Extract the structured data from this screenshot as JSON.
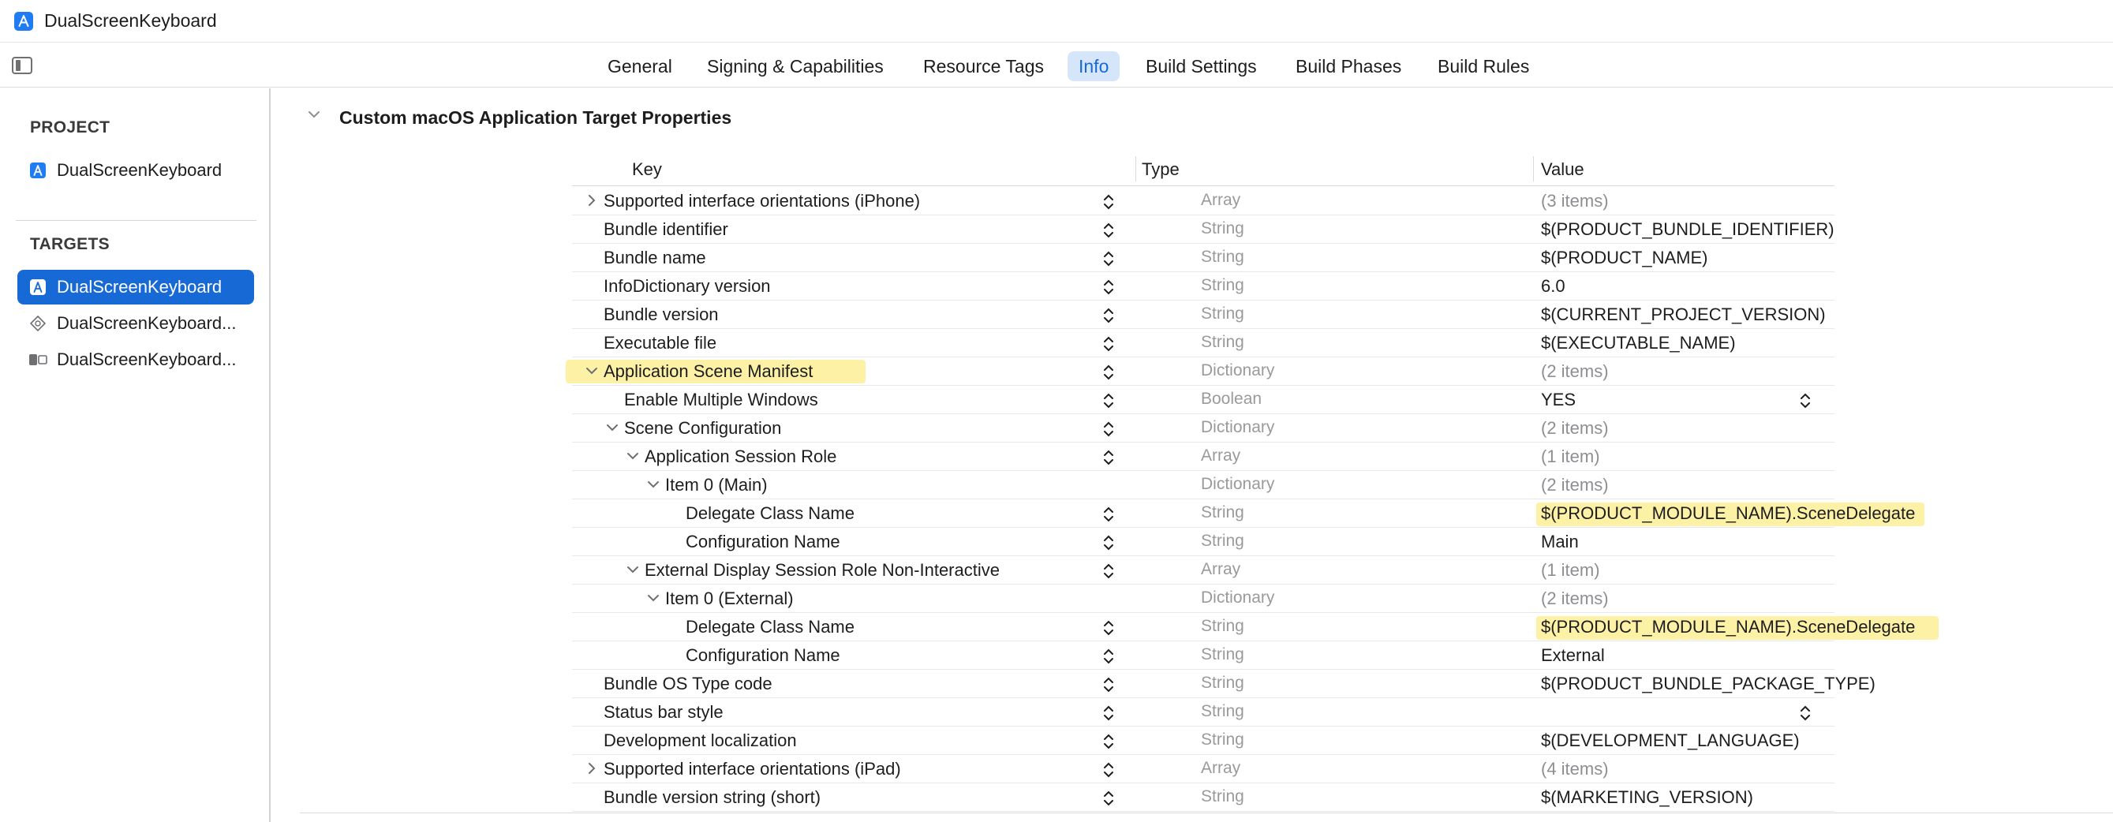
{
  "window": {
    "title": "DualScreenKeyboard"
  },
  "tabs": [
    {
      "label": "General",
      "active": false
    },
    {
      "label": "Signing & Capabilities",
      "active": false
    },
    {
      "label": "Resource Tags",
      "active": false
    },
    {
      "label": "Info",
      "active": true
    },
    {
      "label": "Build Settings",
      "active": false
    },
    {
      "label": "Build Phases",
      "active": false
    },
    {
      "label": "Build Rules",
      "active": false
    }
  ],
  "sidebar": {
    "project_header": "PROJECT",
    "project_item": "DualScreenKeyboard",
    "targets_header": "TARGETS",
    "targets": [
      {
        "label": "DualScreenKeyboard",
        "icon": "app-target-icon",
        "selected": true
      },
      {
        "label": "DualScreenKeyboard...",
        "icon": "extension-target-icon",
        "selected": false
      },
      {
        "label": "DualScreenKeyboard...",
        "icon": "test-target-icon",
        "selected": false
      }
    ]
  },
  "main": {
    "section_title": "Custom macOS Application Target Properties",
    "columns": {
      "key": "Key",
      "type": "Type",
      "value": "Value"
    },
    "rows": [
      {
        "key": "Supported interface orientations (iPhone)",
        "type": "Array",
        "value": "(3 items)",
        "indent": 0,
        "disclosure": "collapsed",
        "stepper": true,
        "value_dim": true
      },
      {
        "key": "Bundle identifier",
        "type": "String",
        "value": "$(PRODUCT_BUNDLE_IDENTIFIER)",
        "indent": 0,
        "stepper": true
      },
      {
        "key": "Bundle name",
        "type": "String",
        "value": "$(PRODUCT_NAME)",
        "indent": 0,
        "stepper": true
      },
      {
        "key": "InfoDictionary version",
        "type": "String",
        "value": "6.0",
        "indent": 0,
        "stepper": true
      },
      {
        "key": "Bundle version",
        "type": "String",
        "value": "$(CURRENT_PROJECT_VERSION)",
        "indent": 0,
        "stepper": true
      },
      {
        "key": "Executable file",
        "type": "String",
        "value": "$(EXECUTABLE_NAME)",
        "indent": 0,
        "stepper": true
      },
      {
        "key": "Application Scene Manifest",
        "type": "Dictionary",
        "value": "(2 items)",
        "indent": 0,
        "disclosure": "expanded",
        "stepper": true,
        "value_dim": true,
        "highlight_key": true
      },
      {
        "key": "Enable Multiple Windows",
        "type": "Boolean",
        "value": "YES",
        "indent": 1,
        "stepper": true,
        "popup": true
      },
      {
        "key": "Scene Configuration",
        "type": "Dictionary",
        "value": "(2 items)",
        "indent": 1,
        "disclosure": "expanded",
        "stepper": true,
        "value_dim": true
      },
      {
        "key": "Application Session Role",
        "type": "Array",
        "value": "(1 item)",
        "indent": 2,
        "disclosure": "expanded",
        "stepper": true,
        "value_dim": true
      },
      {
        "key": "Item 0 (Main)",
        "type": "Dictionary",
        "value": "(2 items)",
        "indent": 3,
        "disclosure": "expanded",
        "stepper": false,
        "value_dim": true
      },
      {
        "key": "Delegate Class Name",
        "type": "String",
        "value": "$(PRODUCT_MODULE_NAME).SceneDelegate",
        "indent": 4,
        "stepper": true,
        "highlight_value": true
      },
      {
        "key": "Configuration Name",
        "type": "String",
        "value": "Main",
        "indent": 4,
        "stepper": true
      },
      {
        "key": "External Display Session Role Non-Interactive",
        "type": "Array",
        "value": "(1 item)",
        "indent": 2,
        "disclosure": "expanded",
        "stepper": true,
        "value_dim": true
      },
      {
        "key": "Item 0 (External)",
        "type": "Dictionary",
        "value": "(2 items)",
        "indent": 3,
        "disclosure": "expanded",
        "stepper": false,
        "value_dim": true
      },
      {
        "key": "Delegate Class Name",
        "type": "String",
        "value": "$(PRODUCT_MODULE_NAME).SceneDelegate",
        "indent": 4,
        "stepper": true,
        "highlight_value": true
      },
      {
        "key": "Configuration Name",
        "type": "String",
        "value": "External",
        "indent": 4,
        "stepper": true
      },
      {
        "key": "Bundle OS Type code",
        "type": "String",
        "value": "$(PRODUCT_BUNDLE_PACKAGE_TYPE)",
        "indent": 0,
        "stepper": true
      },
      {
        "key": "Status bar style",
        "type": "String",
        "value": "",
        "indent": 0,
        "stepper": true,
        "popup": true
      },
      {
        "key": "Development localization",
        "type": "String",
        "value": "$(DEVELOPMENT_LANGUAGE)",
        "indent": 0,
        "stepper": true
      },
      {
        "key": "Supported interface orientations (iPad)",
        "type": "Array",
        "value": "(4 items)",
        "indent": 0,
        "disclosure": "collapsed",
        "stepper": true,
        "value_dim": true
      },
      {
        "key": "Bundle version string (short)",
        "type": "String",
        "value": "$(MARKETING_VERSION)",
        "indent": 0,
        "stepper": true
      }
    ]
  },
  "colors": {
    "accent": "#1769d6",
    "highlight": "#fdf1a6",
    "type_text": "#9a9a9a"
  }
}
